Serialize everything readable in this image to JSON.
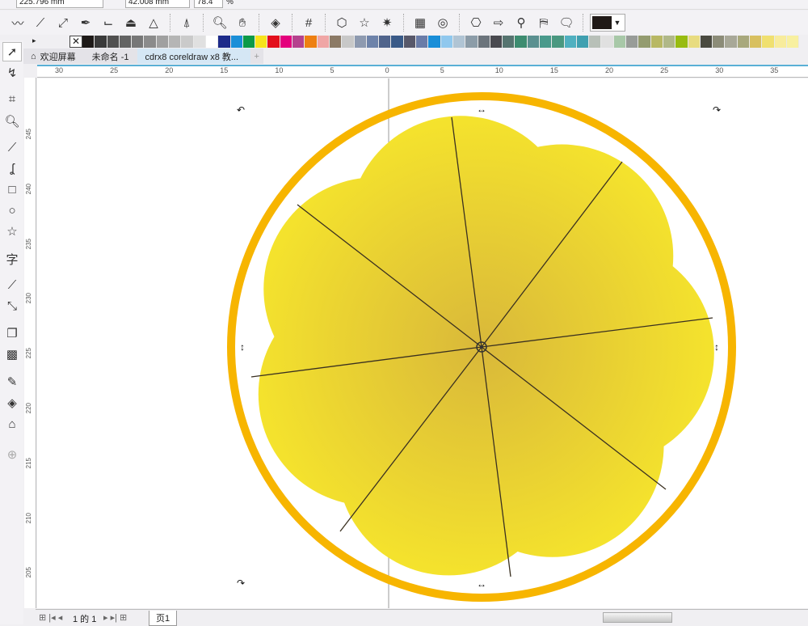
{
  "propbar": {
    "y_value": "225.796 mm",
    "h_value": "42.008 mm",
    "scale": "78.4",
    "scale_unit": "%"
  },
  "toolbar": {
    "icons": [
      "freehand-icon",
      "line-2pt-icon",
      "bezier-icon",
      "pen-icon",
      "b-spline-icon",
      "polyline-icon",
      "3pt-curve-icon",
      "mirror-icon",
      "zoom-icon",
      "pan-icon",
      "fill-icon",
      "grid-icon",
      "polygon-icon",
      "star-icon",
      "complex-star-icon",
      "graph-paper-icon",
      "spiral-icon",
      "basic-shapes-icon",
      "arrow-shapes-icon",
      "flowchart-icon",
      "banner-icon",
      "callout-icon"
    ],
    "outline_color": "#201a17"
  },
  "palette": [
    "#1e1a18",
    "#3a3a3a",
    "#505050",
    "#636363",
    "#777777",
    "#8b8b8b",
    "#a0a0a0",
    "#b5b5b5",
    "#cacaca",
    "#e0e0e0",
    "#ffffff",
    "#1d2b8a",
    "#1b8fd8",
    "#0d9a48",
    "#f7e41c",
    "#e30f1c",
    "#e4007d",
    "#b5428e",
    "#ee8012",
    "#f0a6a6",
    "#8c7a66",
    "#c8c8c8",
    "#8e9ab0",
    "#6e83aa",
    "#50648c",
    "#3a5a88",
    "#58586a",
    "#6a7ca8",
    "#1a8ed8",
    "#90c8ee",
    "#b0c4d4",
    "#8c9ca8",
    "#6c747c",
    "#4a4a50",
    "#567470",
    "#3d8c70",
    "#5a9090",
    "#4a9a8c",
    "#4a9880",
    "#50b0c0",
    "#40a0b0",
    "#b8c0b8",
    "#e0e0e0",
    "#a8c8a8",
    "#989c98",
    "#949c70",
    "#b8b864",
    "#b0b888",
    "#98bc10",
    "#e8dc80",
    "#4a4a40",
    "#8c8c78",
    "#a8a898",
    "#a8a87c",
    "#d8c060",
    "#f0e070",
    "#f8ec9c",
    "#f8f0a0"
  ],
  "tabs": [
    {
      "label": "欢迎屏幕"
    },
    {
      "label": "未命名 -1"
    },
    {
      "label": "cdrx8 coreldraw x8 教..."
    }
  ],
  "hruler": {
    "labels": [
      "30",
      "25",
      "20",
      "15",
      "10",
      "5",
      "0",
      "5",
      "10",
      "15",
      "20",
      "25",
      "30",
      "35"
    ]
  },
  "vruler": {
    "labels": [
      "245",
      "240",
      "235",
      "230",
      "225",
      "220",
      "215",
      "210",
      "205"
    ]
  },
  "toolbox": [
    "pick-tool-icon",
    "shape-tool-icon",
    "crop-tool-icon",
    "zoom-tool-icon",
    "freehand-tool-icon",
    "artistic-media-icon",
    "rectangle-tool-icon",
    "ellipse-tool-icon",
    "polygon-tool-icon",
    "text-tool-icon",
    "parallel-dimension-icon",
    "connector-tool-icon",
    "drop-shadow-icon",
    "transparency-icon",
    "eyedropper-icon",
    "interactive-fill-icon",
    "smart-fill-icon",
    "add-tool-icon"
  ],
  "status": {
    "page_of": "1 的 1",
    "page_tab": "页1"
  },
  "drawing": {
    "ring_color": "#f7b500",
    "petal_color_outer": "#f6e52c",
    "petal_color_inner": "#d9b83a"
  }
}
